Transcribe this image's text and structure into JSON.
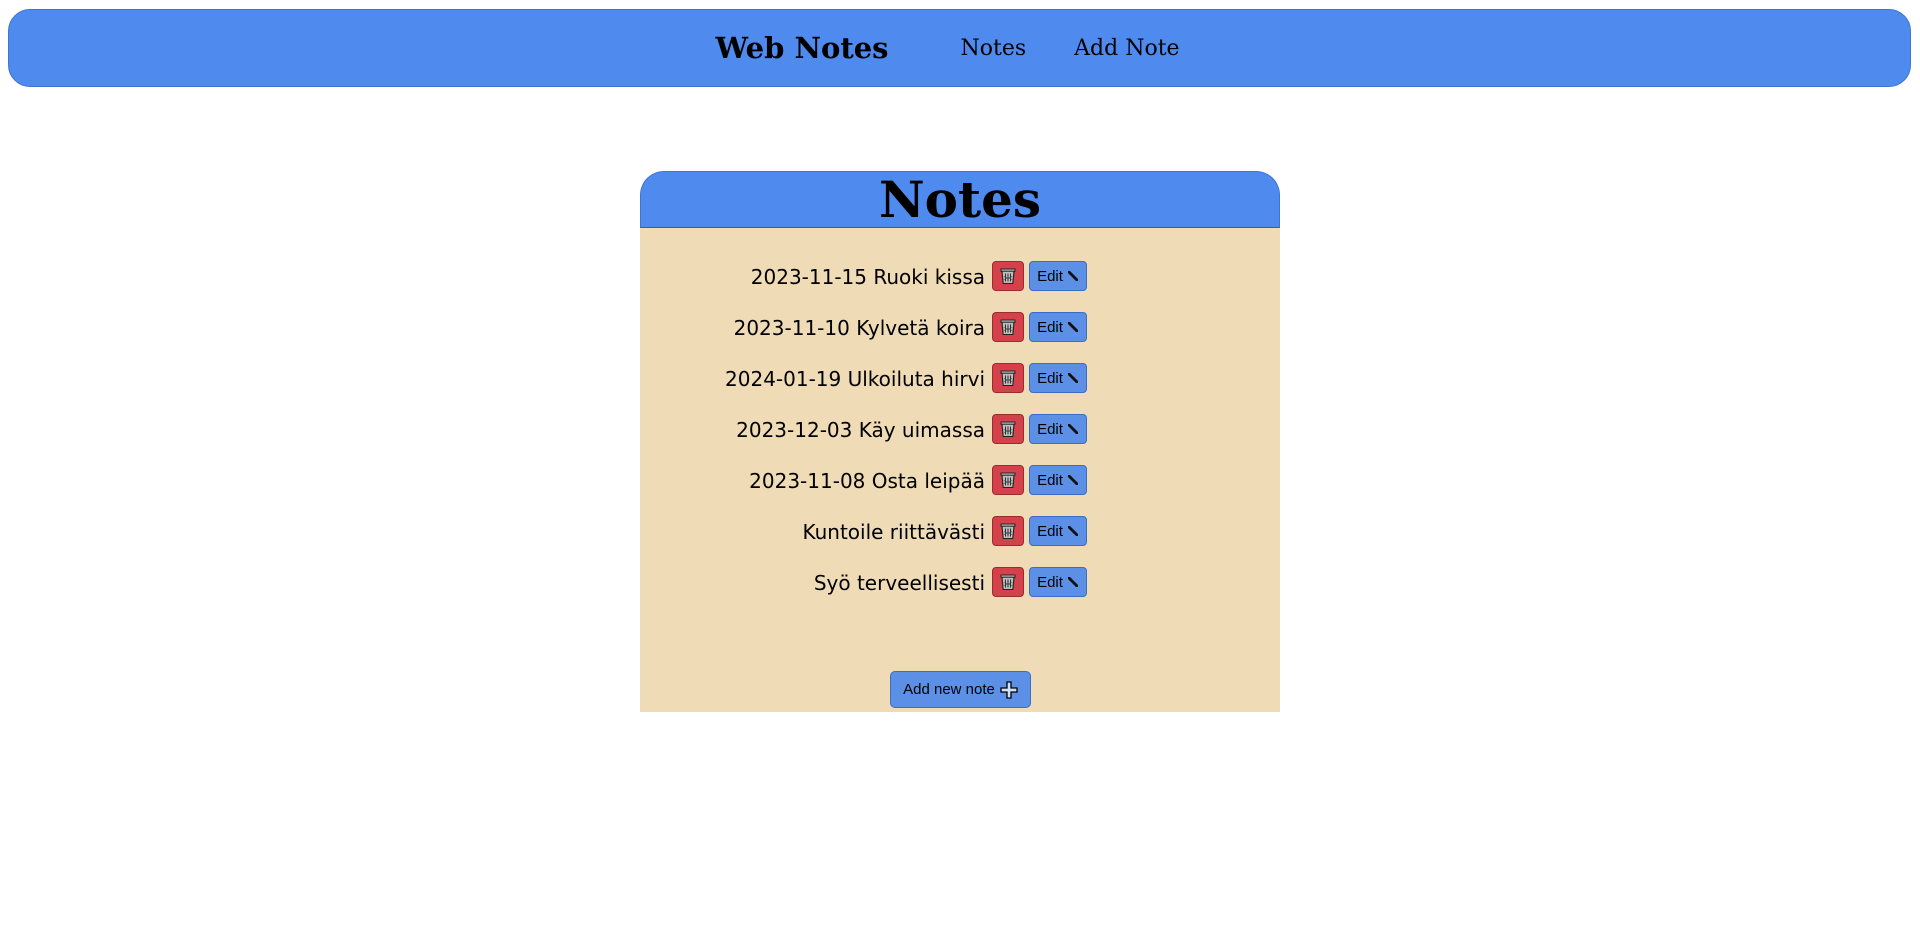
{
  "navbar": {
    "brand": "Web Notes",
    "links": [
      "Notes",
      "Add Note"
    ]
  },
  "panel": {
    "title": "Notes",
    "notes": [
      "2023-11-15 Ruoki kissa",
      "2023-11-10 Kylvetä koira",
      "2024-01-19 Ulkoiluta hirvi",
      "2023-12-03 Käy uimassa",
      "2023-11-08 Osta leipää",
      "Kuntoile riittävästi",
      "Syö terveellisesti"
    ],
    "edit_label": "Edit",
    "add_label": "Add new note"
  },
  "icons": {
    "delete": "trash-icon",
    "edit": "pencil-icon",
    "add": "plus-icon"
  },
  "colors": {
    "primary_blue": "#4f8aee",
    "button_blue": "#5b90e6",
    "delete_red": "#d5414b",
    "panel_bg": "#efdcb7"
  }
}
